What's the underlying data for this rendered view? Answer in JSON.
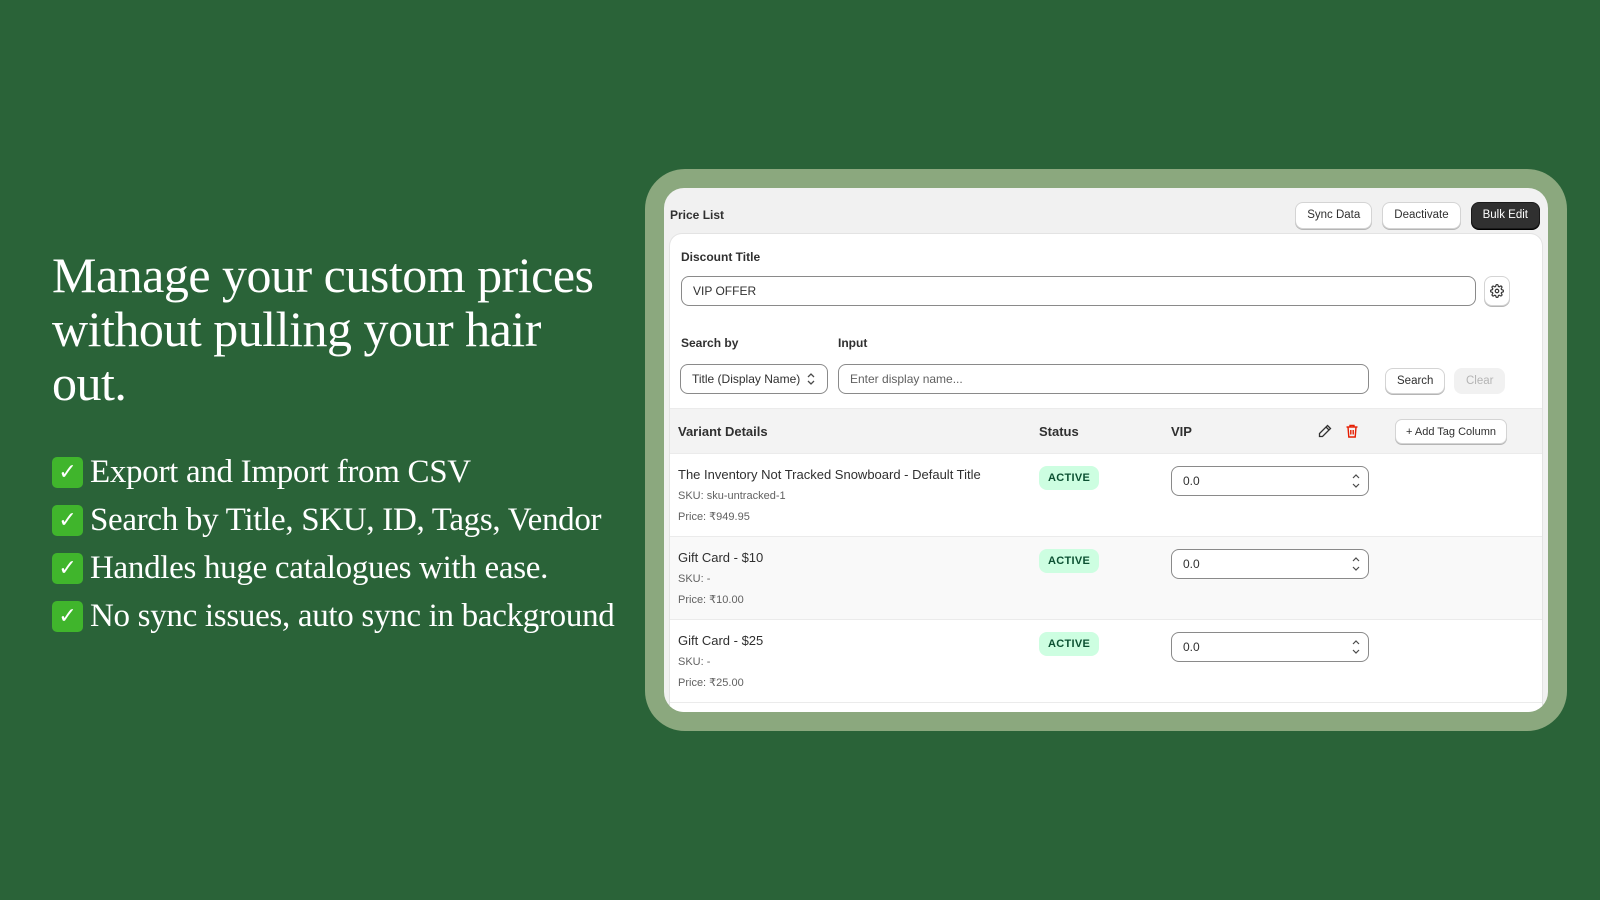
{
  "headline": "Manage your custom prices without pulling your hair out.",
  "features": [
    {
      "icon": "check-mark-icon",
      "text": "Export and Import from CSV"
    },
    {
      "icon": "check-mark-icon",
      "text": "Search by Title, SKU, ID, Tags, Vendor"
    },
    {
      "icon": "check-mark-icon",
      "text": "Handles huge catalogues with ease."
    },
    {
      "icon": "check-mark-icon",
      "text": "No sync issues, auto sync in background"
    }
  ],
  "colors": {
    "background": "#2a6338",
    "frame": "#8ba87e",
    "badge_bg": "#cdfee1",
    "badge_text": "#0c5132",
    "primary_button": "#303030",
    "delete_icon": "#e51c00"
  },
  "app": {
    "title": "Price List",
    "buttons": {
      "sync": "Sync Data",
      "deactivate": "Deactivate",
      "bulk_edit": "Bulk Edit"
    }
  },
  "discount": {
    "label": "Discount Title",
    "value": "VIP OFFER",
    "settings_icon": "gear-icon"
  },
  "search": {
    "by_label": "Search by",
    "by_value": "Title (Display Name)",
    "input_label": "Input",
    "placeholder": "Enter display name...",
    "search_button": "Search",
    "clear_button": "Clear"
  },
  "table": {
    "headers": {
      "details": "Variant Details",
      "status": "Status",
      "vip": "VIP"
    },
    "edit_icon": "pencil-icon",
    "delete_icon": "trash-icon",
    "add_tag_column": "+ Add Tag Column",
    "rows": [
      {
        "title": "The Inventory Not Tracked Snowboard - Default Title",
        "sku": "SKU: sku-untracked-1",
        "price": "Price: ₹949.95",
        "status": "ACTIVE",
        "vip": "0.0"
      },
      {
        "title": "Gift Card - $10",
        "sku": "SKU: -",
        "price": "Price: ₹10.00",
        "status": "ACTIVE",
        "vip": "0.0"
      },
      {
        "title": "Gift Card - $25",
        "sku": "SKU: -",
        "price": "Price: ₹25.00",
        "status": "ACTIVE",
        "vip": "0.0"
      }
    ]
  }
}
